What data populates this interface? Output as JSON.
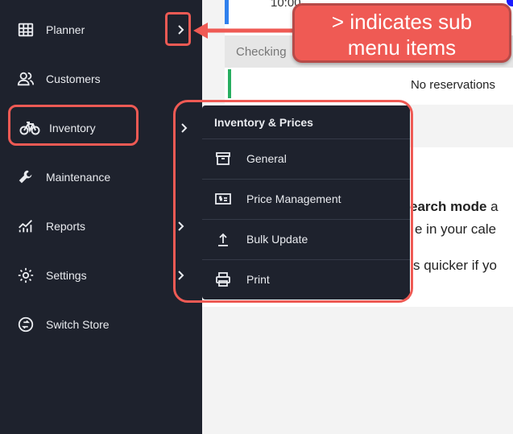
{
  "sidebar": {
    "items": [
      {
        "label": "Planner",
        "icon": "grid-icon"
      },
      {
        "label": "Customers",
        "icon": "customers-icon"
      },
      {
        "label": "Inventory",
        "icon": "bike-icon"
      },
      {
        "label": "Maintenance",
        "icon": "wrench-icon"
      },
      {
        "label": "Reports",
        "icon": "chart-icon"
      },
      {
        "label": "Settings",
        "icon": "gear-icon"
      },
      {
        "label": "Switch Store",
        "icon": "switch-icon"
      }
    ]
  },
  "main": {
    "time": "10:00",
    "checking": "Checking ",
    "no_reservations": "No reservations",
    "info_bold": "earch mode",
    "info_rest": " a",
    "info_line2": "e in your cale",
    "info_line3": "s quicker if yo"
  },
  "submenu": {
    "title": "Inventory & Prices",
    "items": [
      {
        "label": "General",
        "icon": "archive-icon"
      },
      {
        "label": "Price Management",
        "icon": "price-tag-icon"
      },
      {
        "label": "Bulk Update",
        "icon": "upload-icon"
      },
      {
        "label": "Print",
        "icon": "printer-icon"
      }
    ]
  },
  "annotation": {
    "line1": "> indicates sub",
    "line2": "menu items"
  },
  "colors": {
    "sidebar_bg": "#1e222d",
    "annotation_red": "#ef5a54"
  }
}
